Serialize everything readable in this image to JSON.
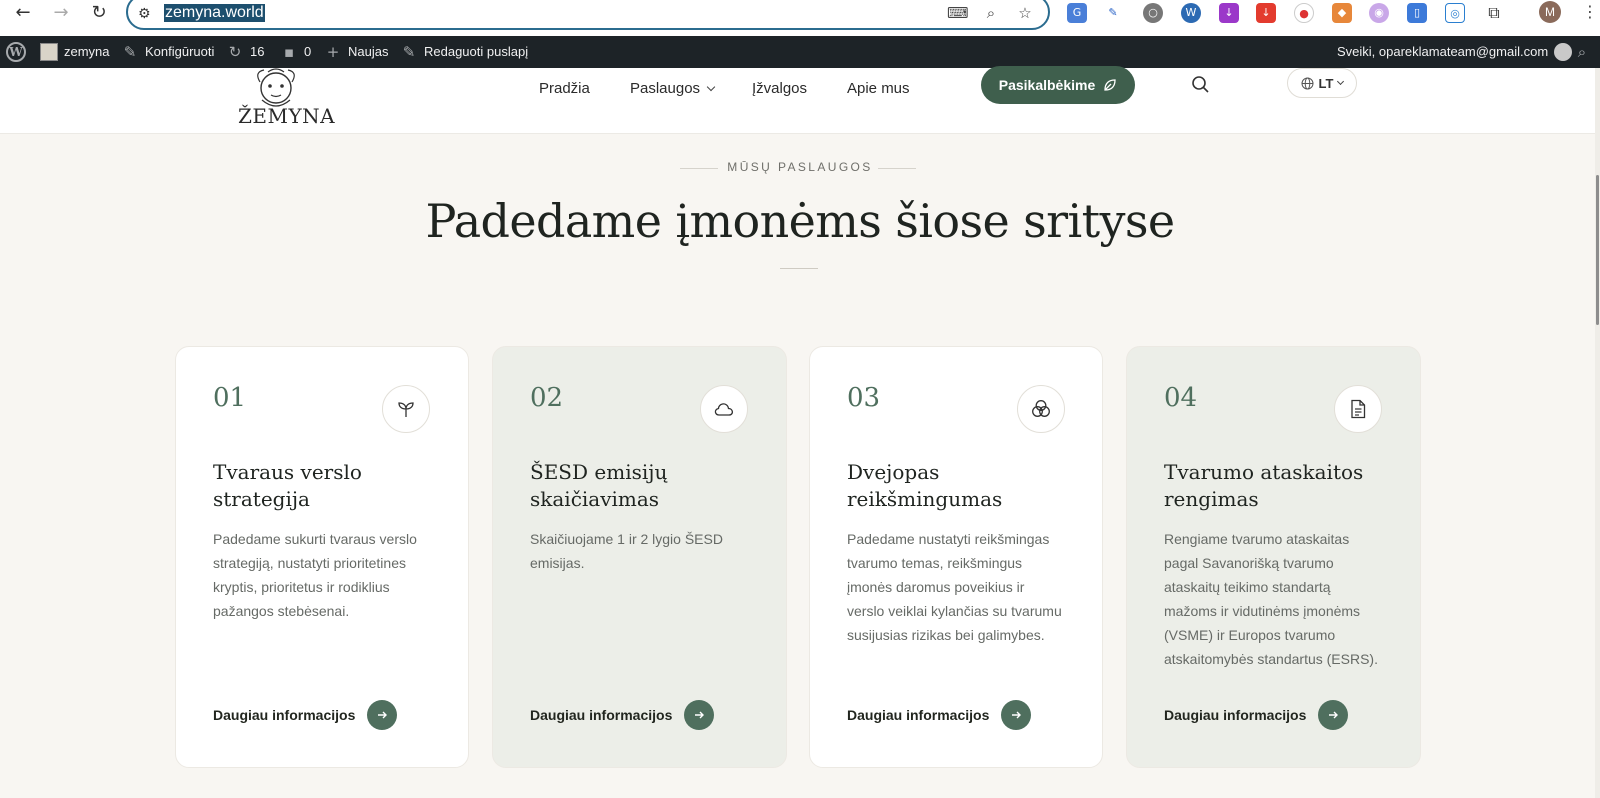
{
  "browser": {
    "url": "zemyna.world"
  },
  "admin_bar": {
    "site_name": "zemyna",
    "customize": "Konfigūruoti",
    "updates_count": "16",
    "comments_count": "0",
    "new_label": "Naujas",
    "edit_page": "Redaguoti puslapį",
    "greeting": "Sveiki, opareklamateam@gmail.com"
  },
  "header": {
    "logo_text": "ŽEMYNA",
    "nav": {
      "home": "Pradžia",
      "services": "Paslaugos",
      "insights": "Įžvalgos",
      "about": "Apie mus"
    },
    "cta_label": "Pasikalbėkime",
    "language": "LT"
  },
  "section": {
    "eyebrow": "MŪSŲ PASLAUGOS",
    "title": "Padedame įmonėms šiose srityse"
  },
  "cards": [
    {
      "number": "01",
      "icon": "sprout-icon",
      "title": "Tvaraus verslo strategija",
      "description": "Padedame sukurti tvaraus verslo strategiją, nustatyti prioritetines kryptis, prioritetus ir rodiklius pažangos stebėsenai.",
      "link": "Daugiau informacijos"
    },
    {
      "number": "02",
      "icon": "cloud-icon",
      "title": "ŠESD emisijų skaičiavimas",
      "description": "Skaičiuojame 1 ir 2 lygio ŠESD emisijas.",
      "link": "Daugiau informacijos"
    },
    {
      "number": "03",
      "icon": "overlapping-circles-icon",
      "title": "Dvejopas reikšmingumas",
      "description": "Padedame nustatyti reikšmingas tvarumo temas, reikšmingus įmonės daromus poveikius ir verslo veiklai kylančias su tvarumu susijusias rizikas bei galimybes.",
      "link": "Daugiau informacijos"
    },
    {
      "number": "04",
      "icon": "document-icon",
      "title": "Tvarumo ataskaitos rengimas",
      "description": "Rengiame tvarumo ataskaitas pagal Savanorišką tvarumo ataskaitų teikimo standartą mažoms ir vidutinėms įmonėms (VSME) ir Europos tvarumo atskaitomybės standartus (ESRS).",
      "link": "Daugiau informacijos"
    }
  ],
  "colors": {
    "accent_green": "#4f6f5e",
    "cta_green": "#3f5f4d",
    "page_bg": "#f8f6f2",
    "card_tint": "#eceee8",
    "admin_bar": "#1d2327"
  }
}
